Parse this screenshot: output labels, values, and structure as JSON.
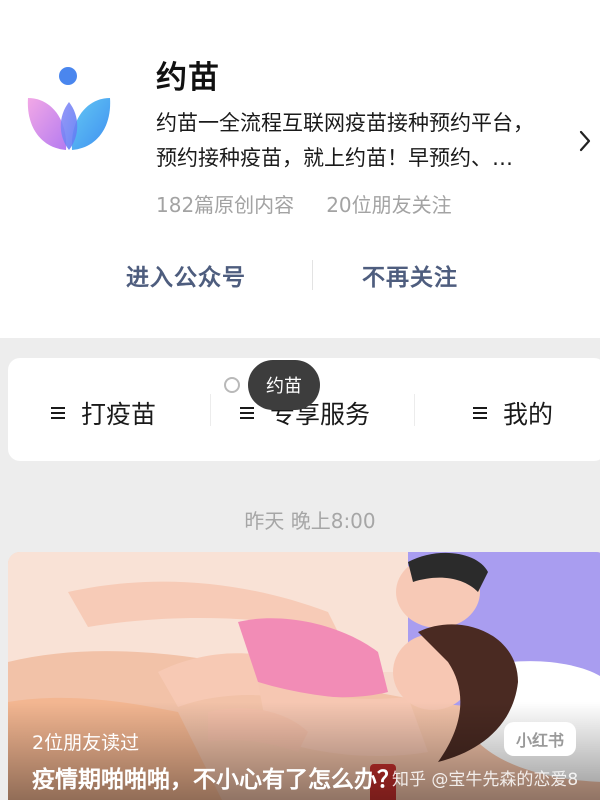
{
  "account": {
    "name": "约苗",
    "description_line1": "约苗一全流程互联网疫苗接种预约平台，",
    "description_line2": "预约接种疫苗，就上约苗！早预约、…",
    "original_count": "182篇原创内容",
    "friends_following": "20位朋友关注"
  },
  "actions": {
    "enter_label": "进入公众号",
    "unfollow_label": "不再关注"
  },
  "menu": {
    "items": [
      {
        "label": "打疫苗"
      },
      {
        "label": "专享服务"
      },
      {
        "label": "我的"
      }
    ],
    "tooltip": "约苗"
  },
  "feed": {
    "time_label": "昨天 晚上8:00"
  },
  "article": {
    "friends_read": "2位朋友读过",
    "title": "疫情期啪啪啪，不小心有了怎么办？",
    "source_badge": "小红书",
    "watermark": "知乎 @宝牛先森的恋爱8"
  },
  "colors": {
    "link_blue_gray": "#4e5d7e",
    "secondary_text": "#a3a3a3",
    "tooltip_bg": "#3d3d3d"
  },
  "icons": {
    "logo": "petal-logo-icon",
    "chevron": "chevron-right-icon",
    "menu": "hamburger-icon"
  }
}
